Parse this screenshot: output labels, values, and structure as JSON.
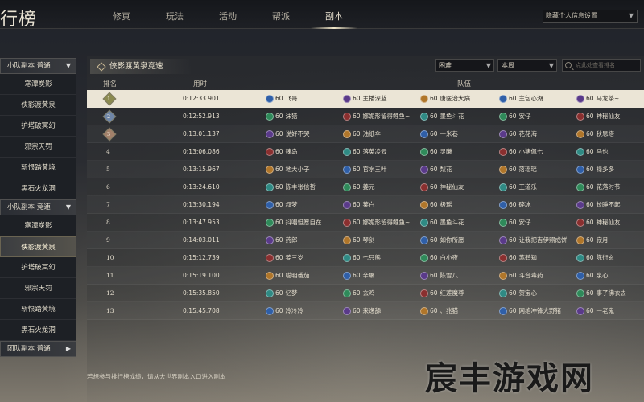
{
  "header": {
    "title": "行榜",
    "tabs": [
      {
        "label": "修真",
        "active": false
      },
      {
        "label": "玩法",
        "active": false
      },
      {
        "label": "活动",
        "active": false
      },
      {
        "label": "帮派",
        "active": false
      },
      {
        "label": "副本",
        "active": true
      }
    ],
    "privacy_setting": "隐藏个人信息设置"
  },
  "sidebar": {
    "groups": [
      {
        "label": "小队副本 普通",
        "expanded": true,
        "items": [
          "寒潭炭影",
          "侠影渡黄泉",
          "护塔破冥幻",
          "邪宗天罚",
          "斩恨踏黄境",
          "黑石火龙洞"
        ]
      },
      {
        "label": "小队副本 竞速",
        "expanded": true,
        "active_index": 1,
        "items": [
          "寒潭炭影",
          "侠影渡黄泉",
          "护塔破冥幻",
          "邪宗天罚",
          "斩恨踏黄境",
          "黑石火龙洞"
        ]
      },
      {
        "label": "团队副本 普通",
        "expanded": false,
        "items": []
      }
    ]
  },
  "panel": {
    "title": "侠影渡黄泉竞速",
    "filter_difficulty": "困难",
    "filter_period": "本周",
    "search_placeholder": "点此处查看排名"
  },
  "table": {
    "headers": {
      "rank": "排名",
      "time": "用时",
      "team": "队伍"
    },
    "rows": [
      {
        "rank": "1",
        "time": "0:12:33.901",
        "members": [
          "飞哥",
          "主播深蓝",
          "唐医治大病",
          "主包心湖",
          "马龙茶~"
        ]
      },
      {
        "rank": "2",
        "time": "0:12:52.913",
        "members": [
          "沫猎",
          "娜妮形留得鲤鱼~",
          "墨鱼斗花",
          "安仔",
          "神秘仙友"
        ]
      },
      {
        "rank": "3",
        "time": "0:13:01.137",
        "members": [
          "说好不哭",
          "油纸伞",
          "一米巷",
          "花花海",
          "秋思塔"
        ]
      },
      {
        "rank": "4",
        "time": "0:13:06.086",
        "members": [
          "辣岛",
          "落英凌云",
          "灵曦",
          "小猪佩七",
          "马也"
        ]
      },
      {
        "rank": "5",
        "time": "0:13:15.967",
        "members": [
          "地大小子",
          "官水三叶",
          "梨花",
          "落瑶瑶",
          "禄多多"
        ]
      },
      {
        "rank": "6",
        "time": "0:13:24.610",
        "members": [
          "陈丰张信哲",
          "姜元",
          "神秘仙友",
          "王道乐",
          "花落时节"
        ]
      },
      {
        "rank": "7",
        "time": "0:13:30.194",
        "members": [
          "叔梦",
          "莱白",
          "极瑶",
          "碎冰",
          "长睡不起"
        ]
      },
      {
        "rank": "8",
        "time": "0:13:47.953",
        "members": [
          "抖唱怛愿自在",
          "娜妮形留得鲤鱼~",
          "墨鱼斗花",
          "安仔",
          "神秘仙友"
        ]
      },
      {
        "rank": "9",
        "time": "0:14:03.011",
        "members": [
          "药郎",
          "琴剑",
          "如你所愿",
          "让我把吉伊照成饼",
          "寂月"
        ]
      },
      {
        "rank": "10",
        "time": "0:15:12.739",
        "members": [
          "姜三岁",
          "七只熊",
          "白小夜",
          "苏鹤知",
          "陈衍玄"
        ]
      },
      {
        "rank": "11",
        "time": "0:15:19.100",
        "members": [
          "聪明番茄",
          "辛屠",
          "陈雪八",
          "斗音毒药",
          "泉心"
        ]
      },
      {
        "rank": "12",
        "time": "0:15:35.850",
        "members": [
          "忆梦",
          "玄鸡",
          "红莲魔尊",
          "贺宝心",
          "事了拂衣去"
        ]
      },
      {
        "rank": "13",
        "time": "0:15:45.708",
        "members": [
          "冷冷冷",
          "来逸舔",
          "、兆猫",
          "网络冲锋大野猪",
          "一老鬼"
        ]
      }
    ],
    "member_level": "60"
  },
  "footer": {
    "note": "若想参与排行榜成绩，请从大世界副本入口进入副本"
  },
  "watermark": "宸丰游戏网",
  "colors": {
    "highlight_row": "#ebe5d6",
    "gold_medal": "#8b8a50",
    "silver_medal": "#6f86a8",
    "bronze_medal": "#a2806a",
    "class_blue": "#2f5fa8",
    "class_green": "#2f8a5a",
    "class_purple": "#5a3a8a",
    "class_red": "#8a2f2f",
    "class_orange": "#b0762a",
    "class_teal": "#2f8a84"
  },
  "icons": {
    "sidebar_expand": "chevron-down-icon",
    "sidebar_collapsed": "chevron-right-icon",
    "search": "search-icon",
    "medal": "rank-medal-icon",
    "member_class": "class-emblem-icon"
  }
}
